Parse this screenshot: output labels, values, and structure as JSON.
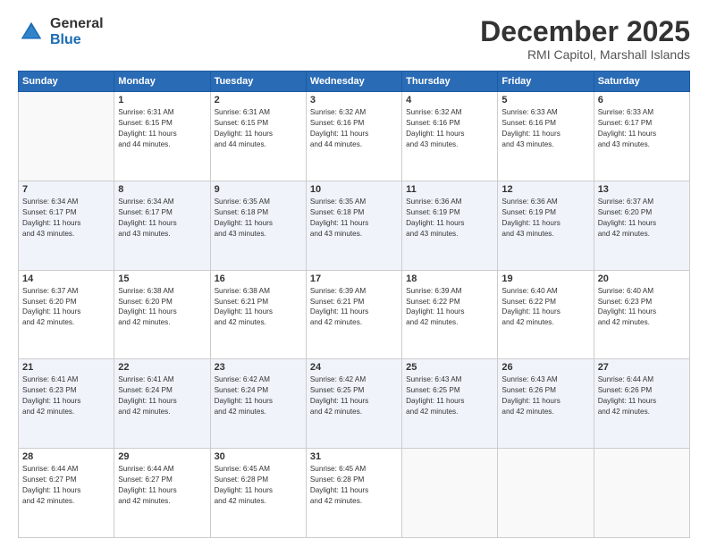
{
  "logo": {
    "general": "General",
    "blue": "Blue"
  },
  "header": {
    "month": "December 2025",
    "location": "RMI Capitol, Marshall Islands"
  },
  "weekdays": [
    "Sunday",
    "Monday",
    "Tuesday",
    "Wednesday",
    "Thursday",
    "Friday",
    "Saturday"
  ],
  "weeks": [
    [
      {
        "day": "",
        "info": ""
      },
      {
        "day": "1",
        "info": "Sunrise: 6:31 AM\nSunset: 6:15 PM\nDaylight: 11 hours\nand 44 minutes."
      },
      {
        "day": "2",
        "info": "Sunrise: 6:31 AM\nSunset: 6:15 PM\nDaylight: 11 hours\nand 44 minutes."
      },
      {
        "day": "3",
        "info": "Sunrise: 6:32 AM\nSunset: 6:16 PM\nDaylight: 11 hours\nand 44 minutes."
      },
      {
        "day": "4",
        "info": "Sunrise: 6:32 AM\nSunset: 6:16 PM\nDaylight: 11 hours\nand 43 minutes."
      },
      {
        "day": "5",
        "info": "Sunrise: 6:33 AM\nSunset: 6:16 PM\nDaylight: 11 hours\nand 43 minutes."
      },
      {
        "day": "6",
        "info": "Sunrise: 6:33 AM\nSunset: 6:17 PM\nDaylight: 11 hours\nand 43 minutes."
      }
    ],
    [
      {
        "day": "7",
        "info": "Sunrise: 6:34 AM\nSunset: 6:17 PM\nDaylight: 11 hours\nand 43 minutes."
      },
      {
        "day": "8",
        "info": "Sunrise: 6:34 AM\nSunset: 6:17 PM\nDaylight: 11 hours\nand 43 minutes."
      },
      {
        "day": "9",
        "info": "Sunrise: 6:35 AM\nSunset: 6:18 PM\nDaylight: 11 hours\nand 43 minutes."
      },
      {
        "day": "10",
        "info": "Sunrise: 6:35 AM\nSunset: 6:18 PM\nDaylight: 11 hours\nand 43 minutes."
      },
      {
        "day": "11",
        "info": "Sunrise: 6:36 AM\nSunset: 6:19 PM\nDaylight: 11 hours\nand 43 minutes."
      },
      {
        "day": "12",
        "info": "Sunrise: 6:36 AM\nSunset: 6:19 PM\nDaylight: 11 hours\nand 43 minutes."
      },
      {
        "day": "13",
        "info": "Sunrise: 6:37 AM\nSunset: 6:20 PM\nDaylight: 11 hours\nand 42 minutes."
      }
    ],
    [
      {
        "day": "14",
        "info": "Sunrise: 6:37 AM\nSunset: 6:20 PM\nDaylight: 11 hours\nand 42 minutes."
      },
      {
        "day": "15",
        "info": "Sunrise: 6:38 AM\nSunset: 6:20 PM\nDaylight: 11 hours\nand 42 minutes."
      },
      {
        "day": "16",
        "info": "Sunrise: 6:38 AM\nSunset: 6:21 PM\nDaylight: 11 hours\nand 42 minutes."
      },
      {
        "day": "17",
        "info": "Sunrise: 6:39 AM\nSunset: 6:21 PM\nDaylight: 11 hours\nand 42 minutes."
      },
      {
        "day": "18",
        "info": "Sunrise: 6:39 AM\nSunset: 6:22 PM\nDaylight: 11 hours\nand 42 minutes."
      },
      {
        "day": "19",
        "info": "Sunrise: 6:40 AM\nSunset: 6:22 PM\nDaylight: 11 hours\nand 42 minutes."
      },
      {
        "day": "20",
        "info": "Sunrise: 6:40 AM\nSunset: 6:23 PM\nDaylight: 11 hours\nand 42 minutes."
      }
    ],
    [
      {
        "day": "21",
        "info": "Sunrise: 6:41 AM\nSunset: 6:23 PM\nDaylight: 11 hours\nand 42 minutes."
      },
      {
        "day": "22",
        "info": "Sunrise: 6:41 AM\nSunset: 6:24 PM\nDaylight: 11 hours\nand 42 minutes."
      },
      {
        "day": "23",
        "info": "Sunrise: 6:42 AM\nSunset: 6:24 PM\nDaylight: 11 hours\nand 42 minutes."
      },
      {
        "day": "24",
        "info": "Sunrise: 6:42 AM\nSunset: 6:25 PM\nDaylight: 11 hours\nand 42 minutes."
      },
      {
        "day": "25",
        "info": "Sunrise: 6:43 AM\nSunset: 6:25 PM\nDaylight: 11 hours\nand 42 minutes."
      },
      {
        "day": "26",
        "info": "Sunrise: 6:43 AM\nSunset: 6:26 PM\nDaylight: 11 hours\nand 42 minutes."
      },
      {
        "day": "27",
        "info": "Sunrise: 6:44 AM\nSunset: 6:26 PM\nDaylight: 11 hours\nand 42 minutes."
      }
    ],
    [
      {
        "day": "28",
        "info": "Sunrise: 6:44 AM\nSunset: 6:27 PM\nDaylight: 11 hours\nand 42 minutes."
      },
      {
        "day": "29",
        "info": "Sunrise: 6:44 AM\nSunset: 6:27 PM\nDaylight: 11 hours\nand 42 minutes."
      },
      {
        "day": "30",
        "info": "Sunrise: 6:45 AM\nSunset: 6:28 PM\nDaylight: 11 hours\nand 42 minutes."
      },
      {
        "day": "31",
        "info": "Sunrise: 6:45 AM\nSunset: 6:28 PM\nDaylight: 11 hours\nand 42 minutes."
      },
      {
        "day": "",
        "info": ""
      },
      {
        "day": "",
        "info": ""
      },
      {
        "day": "",
        "info": ""
      }
    ]
  ]
}
